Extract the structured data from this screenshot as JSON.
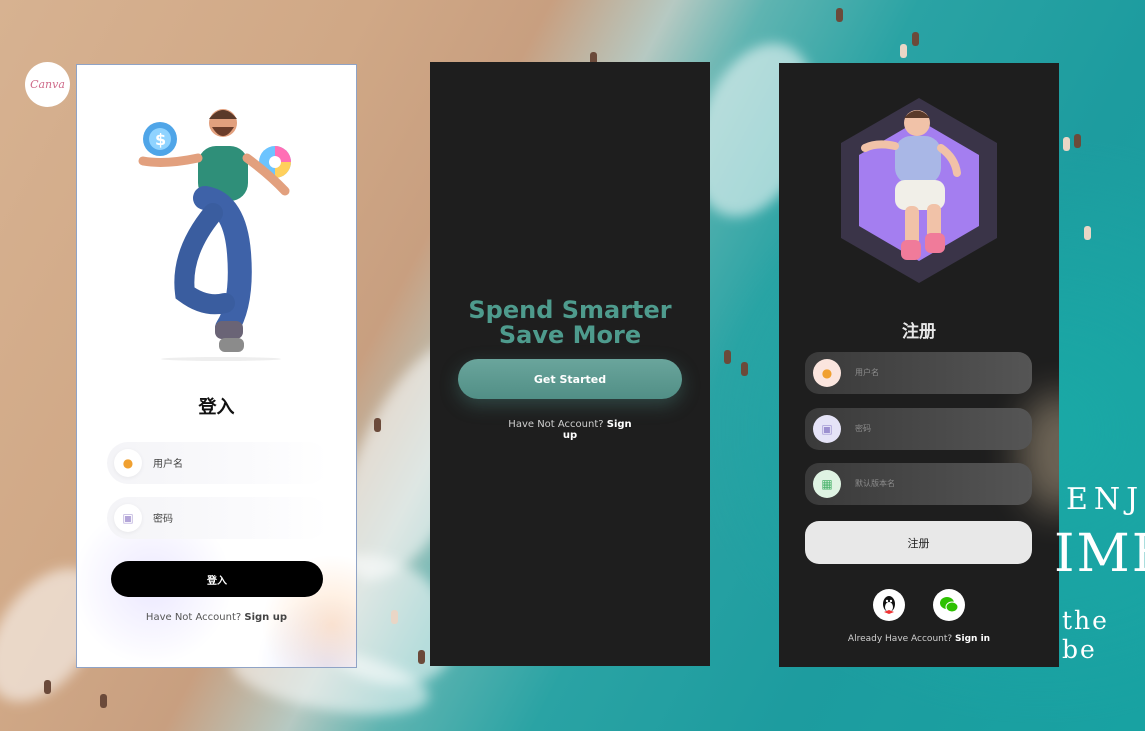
{
  "logo": {
    "text": "Canva"
  },
  "login_card": {
    "title": "登入",
    "username_placeholder": "用户名",
    "password_placeholder": "密码",
    "submit_label": "登入",
    "footer_text": "Have Not Account?",
    "footer_link": "Sign up"
  },
  "onboarding_card": {
    "headline_line1": "Spend Smarter",
    "headline_line2": "Save More",
    "cta_label": "Get Started",
    "footer_text": "Have Not Account?",
    "footer_link_1": "Sign",
    "footer_link_2": "up"
  },
  "register_card": {
    "title": "注册",
    "username_placeholder": "用户名",
    "password_placeholder": "密码",
    "version_placeholder": "默认版本名",
    "submit_label": "注册",
    "social": [
      "qq-icon",
      "wechat-icon"
    ],
    "footer_text": "Already Have Account?",
    "footer_link": "Sign in"
  },
  "background_text": {
    "line1": "ENJ",
    "line2": "IME",
    "line3": "the be"
  },
  "colors": {
    "accent_green": "#4e9b8d",
    "dark_card": "#1e1e1e",
    "primary_black": "#000000"
  }
}
